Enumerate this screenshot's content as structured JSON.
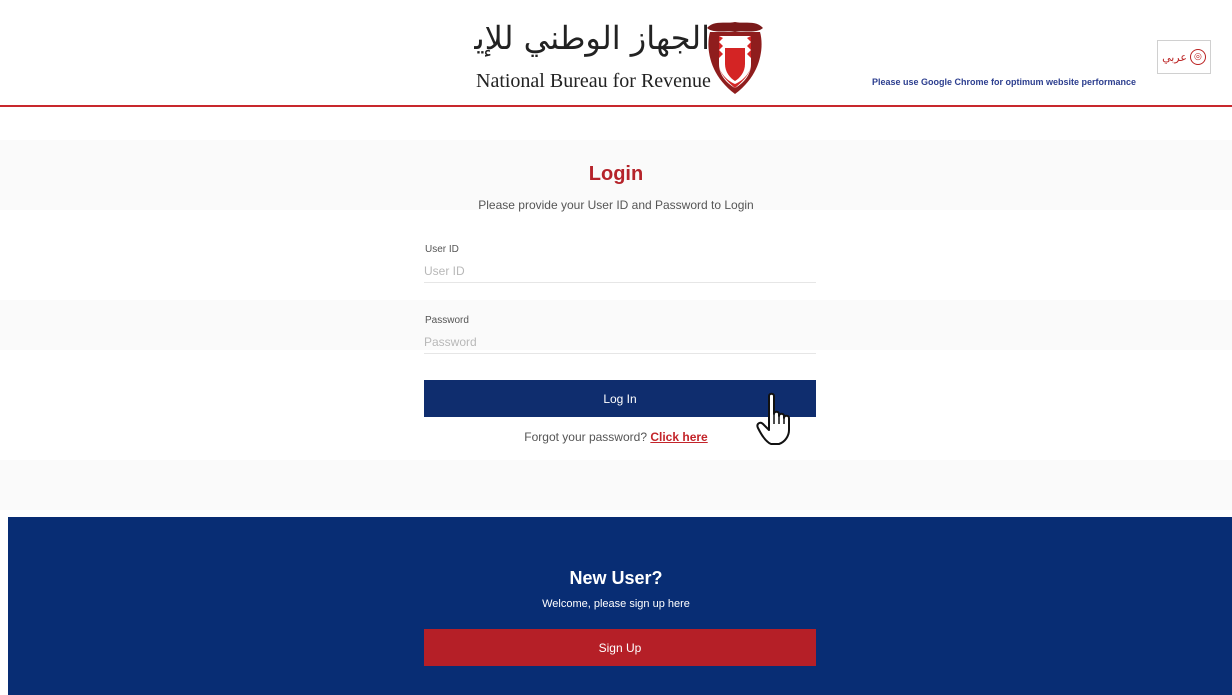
{
  "header": {
    "logo_arabic": "الجهاز الوطني للإيرادات",
    "logo_english": "National Bureau for Revenue",
    "language_toggle": "عربي",
    "chrome_notice": "Please use Google Chrome for optimum website performance"
  },
  "login": {
    "title": "Login",
    "subtitle": "Please provide your User ID and Password to Login",
    "user_id_label": "User ID",
    "user_id_placeholder": "User ID",
    "password_label": "Password",
    "password_placeholder": "Password",
    "submit_label": "Log In",
    "forgot_text": "Forgot your password?",
    "forgot_link": "Click here"
  },
  "signup": {
    "title": "New User?",
    "subtitle": "Welcome, please sign up here",
    "button_label": "Sign Up"
  },
  "icons": {
    "cursor": "hand-pointer-icon",
    "emblem": "bahrain-emblem-icon",
    "language": "language-globe-icon"
  },
  "colors": {
    "primary_navy": "#0f2d6e",
    "accent_red": "#b5232a",
    "footer_navy": "#082d74"
  }
}
